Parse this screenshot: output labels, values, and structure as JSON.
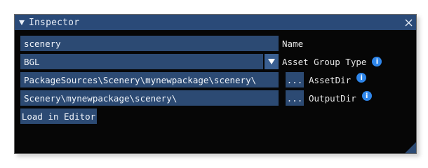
{
  "window": {
    "title": "Inspector",
    "title_bar_color": "#2a4a78",
    "collapse_icon": "triangle-down-icon",
    "close_icon": "close-icon"
  },
  "fields": {
    "name": {
      "value": "scenery",
      "label": "Name"
    },
    "asset_group_type": {
      "value": "BGL",
      "label": "Asset Group Type",
      "dropdown_icon": "triangle-down-icon",
      "info_icon": "info-icon"
    },
    "asset_dir": {
      "value": "PackageSources\\Scenery\\mynewpackage\\scenery\\",
      "browse_label": "...",
      "label": "AssetDir",
      "info_icon": "info-icon"
    },
    "output_dir": {
      "value": "Scenery\\mynewpackage\\scenery\\",
      "browse_label": "...",
      "label": "OutputDir",
      "info_icon": "info-icon"
    }
  },
  "actions": {
    "load_in_editor": "Load in Editor"
  },
  "colors": {
    "field_bg": "#2c4a73",
    "window_bg": "#060606",
    "info_blue": "#2f86ea"
  }
}
